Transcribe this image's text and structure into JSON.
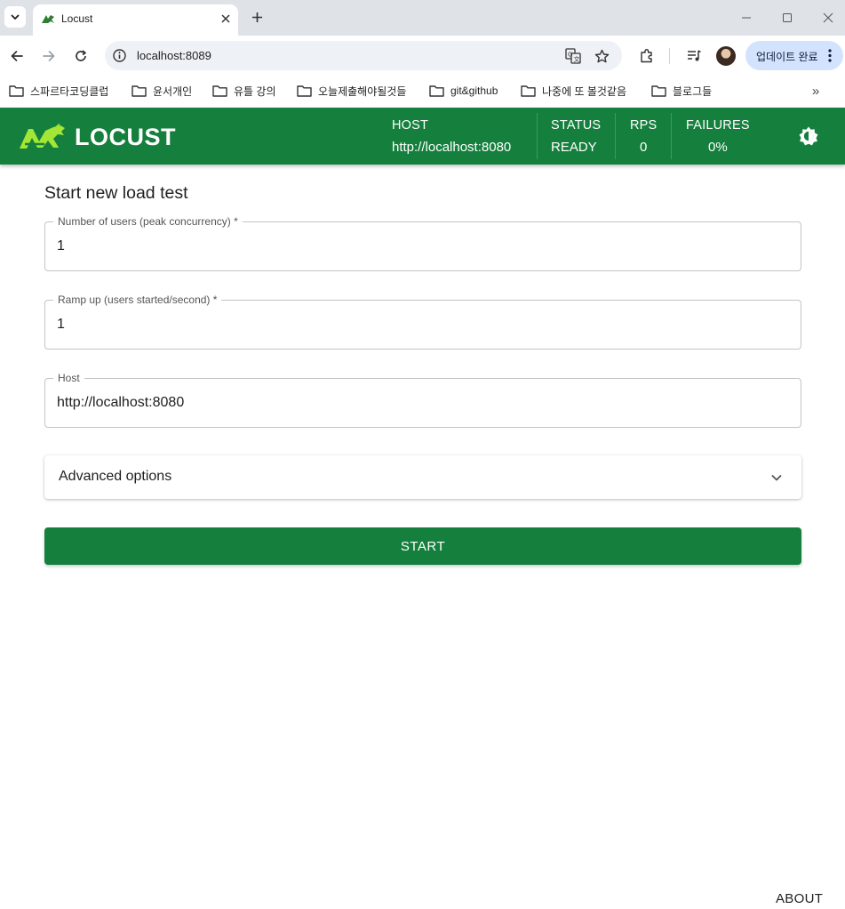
{
  "browser": {
    "tab": {
      "title": "Locust",
      "favicon": "locust-favicon-icon"
    },
    "address": {
      "url": "localhost:8089"
    },
    "update_button": {
      "label": "업데이트 완료"
    },
    "bookmarks": [
      {
        "label": "스파르타코딩클럽"
      },
      {
        "label": "윤서개인"
      },
      {
        "label": "유틀 강의"
      },
      {
        "label": "오늘제출해야될것들"
      },
      {
        "label": "git&github"
      },
      {
        "label": "나중에 또 볼것같음"
      },
      {
        "label": "블로그들"
      }
    ],
    "more_label": "»"
  },
  "app": {
    "brand": "LOCUST",
    "colors": {
      "primary": "#15803d",
      "logo_accent": "#a3e635"
    },
    "stats": {
      "host": {
        "label": "HOST",
        "value": "http://localhost:8080"
      },
      "status": {
        "label": "STATUS",
        "value": "READY"
      },
      "rps": {
        "label": "RPS",
        "value": "0"
      },
      "failures": {
        "label": "FAILURES",
        "value": "0%"
      }
    }
  },
  "form": {
    "title": "Start new load test",
    "users": {
      "label": "Number of users (peak concurrency) *",
      "value": "1"
    },
    "ramp": {
      "label": "Ramp up (users started/second) *",
      "value": "1"
    },
    "host": {
      "label": "Host",
      "value": "http://localhost:8080"
    },
    "advanced": {
      "label": "Advanced options"
    },
    "start_label": "START"
  },
  "footer": {
    "about_label": "ABOUT"
  }
}
